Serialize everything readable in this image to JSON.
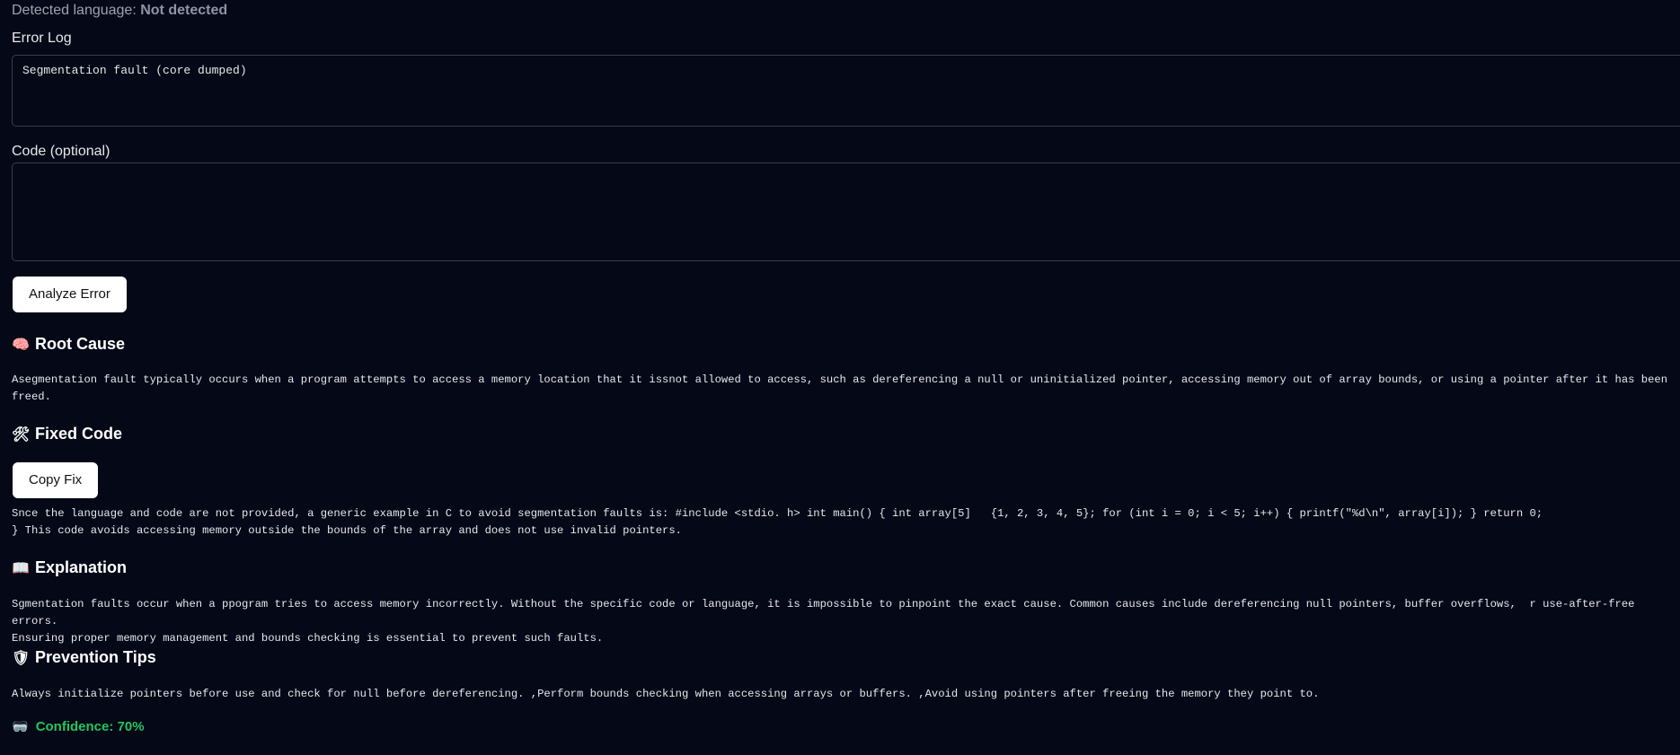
{
  "detected": {
    "prefix": "Detected language: ",
    "value": "Not detected"
  },
  "error_log": {
    "label": "Error Log",
    "value": "Segmentation fault (core dumped)"
  },
  "code": {
    "label": "Code (optional)",
    "value": ""
  },
  "analyze_button": "Analyze Error",
  "root_cause": {
    "icon": "🧠",
    "title": "Root Cause",
    "text": "Asegmentation fault typically occurs when a program attempts to access a memory location that it issnot allowed to access, such as dereferencing a null or uninitialized pointer, accessing memory out of array bounds, or using a pointer after it has been freed."
  },
  "fixed_code": {
    "icon": "🛠",
    "title": "Fixed Code",
    "copy_button": "Copy Fix",
    "text": "Snce the language and code are not provided, a generic example in C to avoid segmentation faults is: #include <stdio. h> int main() { int array[5]   {1, 2, 3, 4, 5}; for (int i = 0; i < 5; i++) { printf(\"%d\\n\", array[i]); } return 0;\n} This code avoids accessing memory outside the bounds of the array and does not use invalid pointers."
  },
  "explanation": {
    "icon": "📖",
    "title": "Explanation",
    "text": "Sgmentation faults occur when a ppogram tries to access memory incorrectly. Without the specific code or language, it is impossible to pinpoint the exact cause. Common causes include dereferencing null pointers, buffer overflows,  r use-after-free errors.\nEnsuring proper memory management and bounds checking is essential to prevent such faults."
  },
  "prevention": {
    "icon": "🛡",
    "title": "Prevention Tips",
    "text": "Always initialize pointers before use and check for null before dereferencing. ,Perform bounds checking when accessing arrays or buffers. ,Avoid using pointers after freeing the memory they point to."
  },
  "confidence": {
    "icon": "🥽",
    "text": "Confidence: 70%"
  },
  "colors": {
    "background": "#050816",
    "confidence": "#22c55e",
    "button_bg": "#ffffff"
  }
}
